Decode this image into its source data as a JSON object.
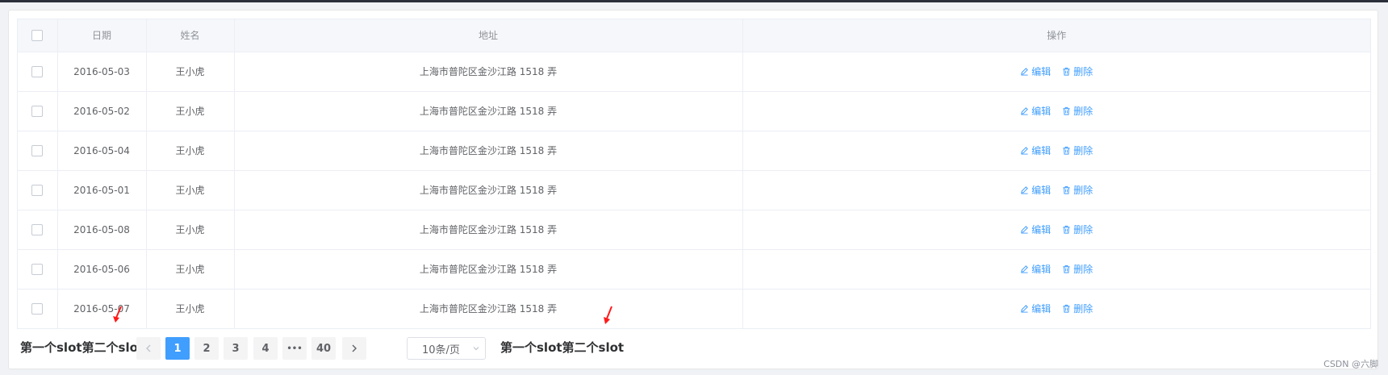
{
  "table": {
    "headers": {
      "date": "日期",
      "name": "姓名",
      "address": "地址",
      "actions": "操作"
    },
    "rows": [
      {
        "date": "2016-05-03",
        "name": "王小虎",
        "address": "上海市普陀区金沙江路 1518 弄"
      },
      {
        "date": "2016-05-02",
        "name": "王小虎",
        "address": "上海市普陀区金沙江路 1518 弄"
      },
      {
        "date": "2016-05-04",
        "name": "王小虎",
        "address": "上海市普陀区金沙江路 1518 弄"
      },
      {
        "date": "2016-05-01",
        "name": "王小虎",
        "address": "上海市普陀区金沙江路 1518 弄"
      },
      {
        "date": "2016-05-08",
        "name": "王小虎",
        "address": "上海市普陀区金沙江路 1518 弄"
      },
      {
        "date": "2016-05-06",
        "name": "王小虎",
        "address": "上海市普陀区金沙江路 1518 弄"
      },
      {
        "date": "2016-05-07",
        "name": "王小虎",
        "address": "上海市普陀区金沙江路 1518 弄"
      }
    ],
    "edit_label": "编辑",
    "delete_label": "删除"
  },
  "pagination": {
    "left_slot": "第一个slot第二个slot",
    "right_slot": "第一个slot第二个slot",
    "pages": [
      "1",
      "2",
      "3",
      "4",
      "•••",
      "40"
    ],
    "current_page": "1",
    "page_size": "10条/页"
  },
  "watermark": "CSDN @六脚",
  "colors": {
    "accent": "#409eff",
    "annotation_arrow": "#ff1a1a"
  }
}
